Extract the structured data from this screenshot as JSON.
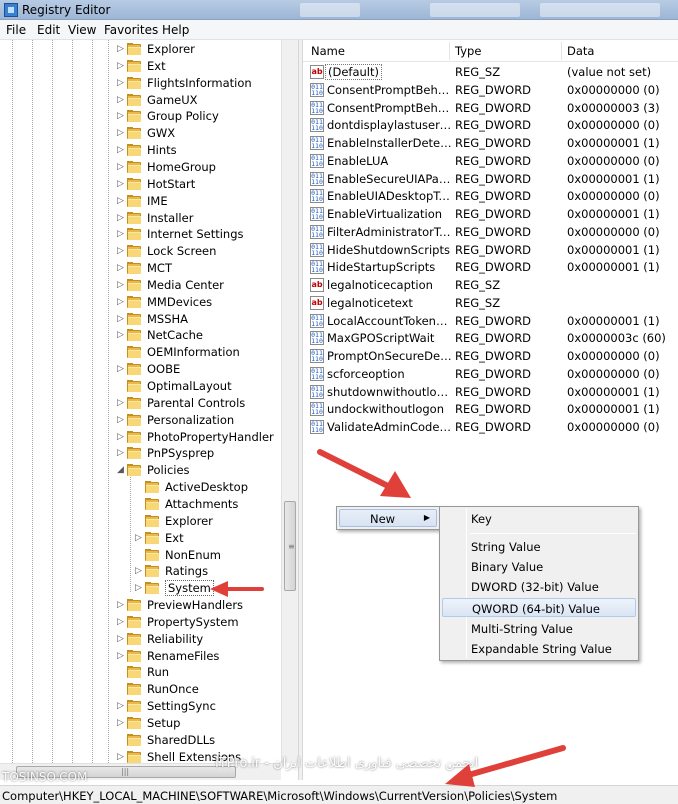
{
  "window": {
    "title": "Registry Editor"
  },
  "menu": [
    "File",
    "Edit",
    "View",
    "Favorites",
    "Help"
  ],
  "tree": [
    {
      "label": "Explorer",
      "level": 1,
      "expander": "▷"
    },
    {
      "label": "Ext",
      "level": 1,
      "expander": "▷"
    },
    {
      "label": "FlightsInformation",
      "level": 1,
      "expander": "▷"
    },
    {
      "label": "GameUX",
      "level": 1,
      "expander": "▷"
    },
    {
      "label": "Group Policy",
      "level": 1,
      "expander": "▷"
    },
    {
      "label": "GWX",
      "level": 1,
      "expander": "▷"
    },
    {
      "label": "Hints",
      "level": 1,
      "expander": "▷"
    },
    {
      "label": "HomeGroup",
      "level": 1,
      "expander": "▷"
    },
    {
      "label": "HotStart",
      "level": 1,
      "expander": "▷"
    },
    {
      "label": "IME",
      "level": 1,
      "expander": "▷"
    },
    {
      "label": "Installer",
      "level": 1,
      "expander": "▷"
    },
    {
      "label": "Internet Settings",
      "level": 1,
      "expander": "▷"
    },
    {
      "label": "Lock Screen",
      "level": 1,
      "expander": "▷"
    },
    {
      "label": "MCT",
      "level": 1,
      "expander": "▷"
    },
    {
      "label": "Media Center",
      "level": 1,
      "expander": "▷"
    },
    {
      "label": "MMDevices",
      "level": 1,
      "expander": "▷"
    },
    {
      "label": "MSSHA",
      "level": 1,
      "expander": "▷"
    },
    {
      "label": "NetCache",
      "level": 1,
      "expander": "▷"
    },
    {
      "label": "OEMInformation",
      "level": 1,
      "expander": ""
    },
    {
      "label": "OOBE",
      "level": 1,
      "expander": "▷"
    },
    {
      "label": "OptimalLayout",
      "level": 1,
      "expander": ""
    },
    {
      "label": "Parental Controls",
      "level": 1,
      "expander": "▷"
    },
    {
      "label": "Personalization",
      "level": 1,
      "expander": "▷"
    },
    {
      "label": "PhotoPropertyHandler",
      "level": 1,
      "expander": "▷"
    },
    {
      "label": "PnPSysprep",
      "level": 1,
      "expander": "▷"
    },
    {
      "label": "Policies",
      "level": 1,
      "expander": "◢"
    },
    {
      "label": "ActiveDesktop",
      "level": 2,
      "expander": ""
    },
    {
      "label": "Attachments",
      "level": 2,
      "expander": ""
    },
    {
      "label": "Explorer",
      "level": 2,
      "expander": ""
    },
    {
      "label": "Ext",
      "level": 2,
      "expander": "▷"
    },
    {
      "label": "NonEnum",
      "level": 2,
      "expander": ""
    },
    {
      "label": "Ratings",
      "level": 2,
      "expander": "▷"
    },
    {
      "label": "System",
      "level": 2,
      "expander": "▷",
      "selected": true
    },
    {
      "label": "PreviewHandlers",
      "level": 1,
      "expander": "▷"
    },
    {
      "label": "PropertySystem",
      "level": 1,
      "expander": "▷"
    },
    {
      "label": "Reliability",
      "level": 1,
      "expander": "▷"
    },
    {
      "label": "RenameFiles",
      "level": 1,
      "expander": "▷"
    },
    {
      "label": "Run",
      "level": 1,
      "expander": ""
    },
    {
      "label": "RunOnce",
      "level": 1,
      "expander": ""
    },
    {
      "label": "SettingSync",
      "level": 1,
      "expander": "▷"
    },
    {
      "label": "Setup",
      "level": 1,
      "expander": "▷"
    },
    {
      "label": "SharedDLLs",
      "level": 1,
      "expander": ""
    },
    {
      "label": "Shell Extensions",
      "level": 1,
      "expander": "▷"
    }
  ],
  "columns": {
    "name": "Name",
    "type": "Type",
    "data": "Data"
  },
  "values": [
    {
      "name": "(Default)",
      "type": "REG_SZ",
      "data": "(value not set)",
      "icon": "string-value-icon"
    },
    {
      "name": "ConsentPromptBehaviorAdmin",
      "type": "REG_DWORD",
      "data": "0x00000000 (0)",
      "icon": "binary-value-icon"
    },
    {
      "name": "ConsentPromptBehaviorUser",
      "type": "REG_DWORD",
      "data": "0x00000003 (3)",
      "icon": "binary-value-icon"
    },
    {
      "name": "dontdisplaylastusername",
      "type": "REG_DWORD",
      "data": "0x00000000 (0)",
      "icon": "binary-value-icon"
    },
    {
      "name": "EnableInstallerDetection",
      "type": "REG_DWORD",
      "data": "0x00000001 (1)",
      "icon": "binary-value-icon"
    },
    {
      "name": "EnableLUA",
      "type": "REG_DWORD",
      "data": "0x00000000 (0)",
      "icon": "binary-value-icon"
    },
    {
      "name": "EnableSecureUIAPaths",
      "type": "REG_DWORD",
      "data": "0x00000001 (1)",
      "icon": "binary-value-icon"
    },
    {
      "name": "EnableUIADesktopToggle",
      "type": "REG_DWORD",
      "data": "0x00000000 (0)",
      "icon": "binary-value-icon"
    },
    {
      "name": "EnableVirtualization",
      "type": "REG_DWORD",
      "data": "0x00000001 (1)",
      "icon": "binary-value-icon"
    },
    {
      "name": "FilterAdministratorToken",
      "type": "REG_DWORD",
      "data": "0x00000000 (0)",
      "icon": "binary-value-icon"
    },
    {
      "name": "HideShutdownScripts",
      "type": "REG_DWORD",
      "data": "0x00000001 (1)",
      "icon": "binary-value-icon"
    },
    {
      "name": "HideStartupScripts",
      "type": "REG_DWORD",
      "data": "0x00000001 (1)",
      "icon": "binary-value-icon"
    },
    {
      "name": "legalnoticecaption",
      "type": "REG_SZ",
      "data": "",
      "icon": "string-value-icon"
    },
    {
      "name": "legalnoticetext",
      "type": "REG_SZ",
      "data": "",
      "icon": "string-value-icon"
    },
    {
      "name": "LocalAccountTokenFilterPolicy",
      "type": "REG_DWORD",
      "data": "0x00000001 (1)",
      "icon": "binary-value-icon"
    },
    {
      "name": "MaxGPOScriptWait",
      "type": "REG_DWORD",
      "data": "0x0000003c (60)",
      "icon": "binary-value-icon"
    },
    {
      "name": "PromptOnSecureDesktop",
      "type": "REG_DWORD",
      "data": "0x00000000 (0)",
      "icon": "binary-value-icon"
    },
    {
      "name": "scforceoption",
      "type": "REG_DWORD",
      "data": "0x00000000 (0)",
      "icon": "binary-value-icon"
    },
    {
      "name": "shutdownwithoutlogon",
      "type": "REG_DWORD",
      "data": "0x00000001 (1)",
      "icon": "binary-value-icon"
    },
    {
      "name": "undockwithoutlogon",
      "type": "REG_DWORD",
      "data": "0x00000001 (1)",
      "icon": "binary-value-icon"
    },
    {
      "name": "ValidateAdminCodeSignatures",
      "type": "REG_DWORD",
      "data": "0x00000000 (0)",
      "icon": "binary-value-icon"
    }
  ],
  "context_menu": {
    "new_label": "New",
    "submenu": [
      {
        "label": "Key"
      },
      {
        "label": "String Value"
      },
      {
        "label": "Binary Value"
      },
      {
        "label": "DWORD (32-bit) Value"
      },
      {
        "label": "QWORD (64-bit) Value",
        "highlighted": true
      },
      {
        "label": "Multi-String Value"
      },
      {
        "label": "Expandable String Value"
      }
    ]
  },
  "statusbar": {
    "path": "Computer\\HKEY_LOCAL_MACHINE\\SOFTWARE\\Microsoft\\Windows\\CurrentVersion\\Policies\\System"
  },
  "watermarks": {
    "left": "TOSINSO.COM",
    "right": "ITPro.ir - انجمن تخصصی فناوری اطلاعات ایران"
  },
  "colors": {
    "arrow": "#e0403a",
    "folder": "#f8d777",
    "menu_highlight": "#dae5f3"
  }
}
